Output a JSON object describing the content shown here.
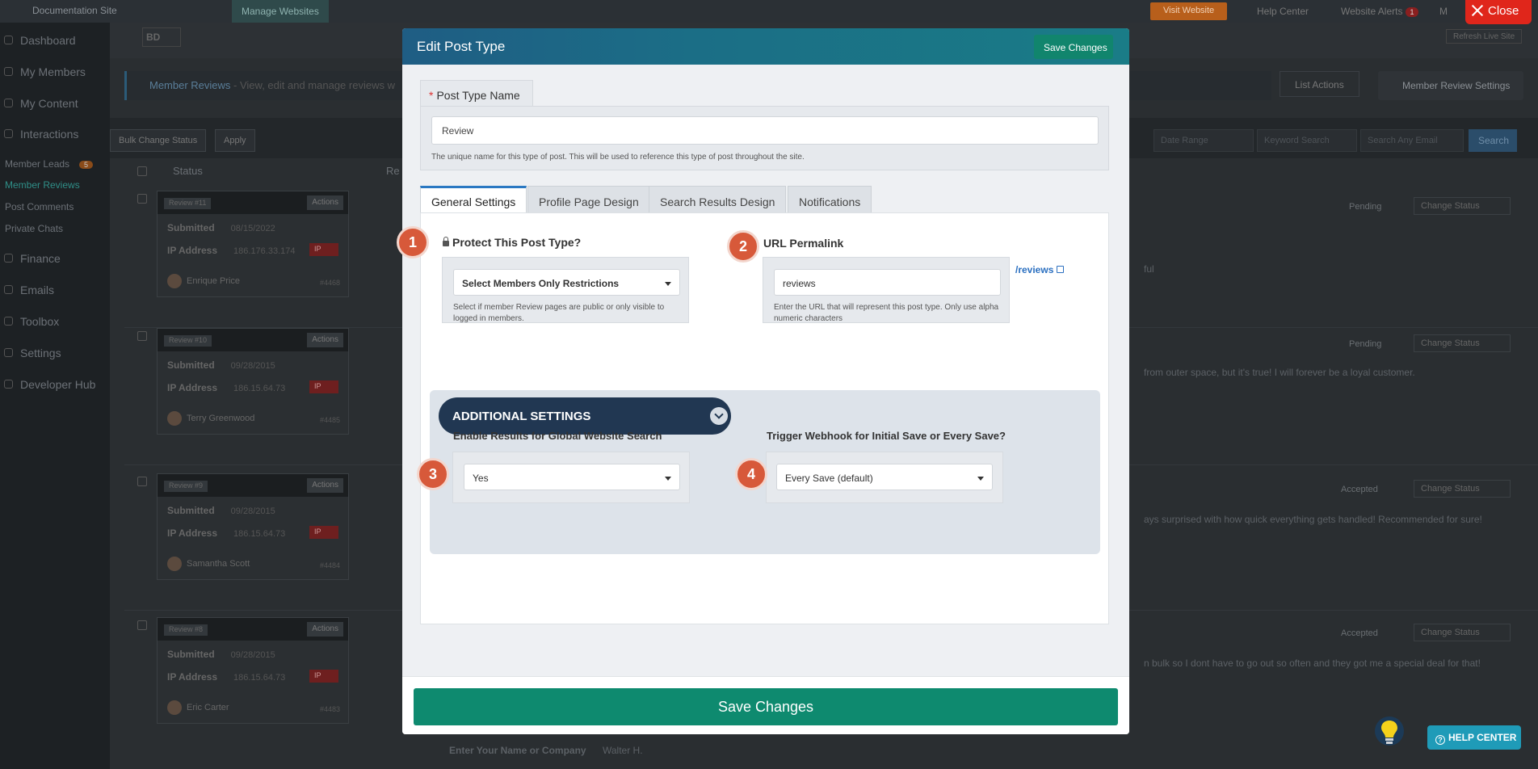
{
  "topbar": {
    "site_name": "Documentation Site",
    "manage_label": "Manage Websites",
    "visit_label": "Visit Website",
    "help_label": "Help Center",
    "alerts_label": "Website Alerts",
    "alerts_count": "1"
  },
  "sidebar": {
    "items": [
      "Dashboard",
      "My Members",
      "My Content",
      "Interactions",
      "Finance",
      "Emails",
      "Toolbox",
      "Settings",
      "Developer Hub"
    ],
    "subitems": [
      "Member Leads",
      "Member Reviews",
      "Post Comments",
      "Private Chats"
    ],
    "leads_badge": "5"
  },
  "page": {
    "info_title": "Member Reviews",
    "info_rest": " - View, edit and manage reviews w",
    "list_actions": "List Actions",
    "settings_button": "Member Review Settings",
    "refresh_label": "Refresh Live Site",
    "bulk_label": "Bulk Change Status",
    "apply_label": "Apply",
    "date_placeholder": "Date Range",
    "keyword_placeholder": "Keyword Search",
    "email_placeholder": "Search Any Email",
    "search_label": "Search",
    "col_status": "Status",
    "col_review": "Re"
  },
  "reviews": [
    {
      "tag": "Review #11",
      "date": "08/15/2022",
      "ip": "186.176.33.174",
      "name": "Enrique Price",
      "num": "#4468",
      "status": "Pending",
      "text": "ful"
    },
    {
      "tag": "Review #10",
      "date": "09/28/2015",
      "ip": "186.15.64.73",
      "name": "Terry Greenwood",
      "num": "#4485",
      "status": "Pending",
      "text": "from outer space, but it's true! I will forever be a loyal customer."
    },
    {
      "tag": "Review #9",
      "date": "09/28/2015",
      "ip": "186.15.64.73",
      "name": "Samantha Scott",
      "num": "#4484",
      "status": "Accepted",
      "text": "ays surprised with how quick everything gets handled! Recommended for sure!"
    },
    {
      "tag": "Review #8",
      "date": "09/28/2015",
      "ip": "186.15.64.73",
      "name": "Eric Carter",
      "num": "#4483",
      "status": "Accepted",
      "text": "n bulk so I dont have to go out so often and they got me a special deal for that!"
    }
  ],
  "review_labels": {
    "submitted": "Submitted",
    "ip_address": "IP Address",
    "actions": "Actions",
    "ip_badge": "IP",
    "change_status": "Change Status"
  },
  "below_modal": {
    "label": "Enter Your Name or Company",
    "value": "Walter H."
  },
  "modal": {
    "title": "Edit Post Type",
    "header_save": "Save Changes",
    "post_type_name_label": "Post Type Name",
    "post_type_name_value": "Review",
    "post_type_name_help": "The unique name for this type of post. This will be used to reference this type of post throughout the site.",
    "tabs": [
      "General Settings",
      "Profile Page Design",
      "Search Results Design",
      "Notifications"
    ],
    "protect_label": "Protect This Post Type?",
    "protect_value": "Select Members Only Restrictions",
    "protect_help": "Select if member Review pages are public or only visible to logged in members.",
    "permalink_label": "URL Permalink",
    "permalink_link": "/reviews",
    "permalink_value": "reviews",
    "permalink_help": "Enter the URL that will represent this post type. Only use alpha numeric characters",
    "additional_settings": "ADDITIONAL SETTINGS",
    "global_search_label": "Enable Results for Global Website Search",
    "global_search_value": "Yes",
    "webhook_label": "Trigger Webhook for Initial Save or Every Save?",
    "webhook_value": "Every Save (default)",
    "footer_save": "Save Changes"
  },
  "steps": [
    "1",
    "2",
    "3",
    "4"
  ],
  "close_label": "Close",
  "help_center_label": "HELP CENTER",
  "colors": {
    "accent": "#0e8a6f",
    "header": "#1f5d84",
    "step": "#d7593a",
    "close": "#e0261b",
    "pill": "#213752"
  }
}
